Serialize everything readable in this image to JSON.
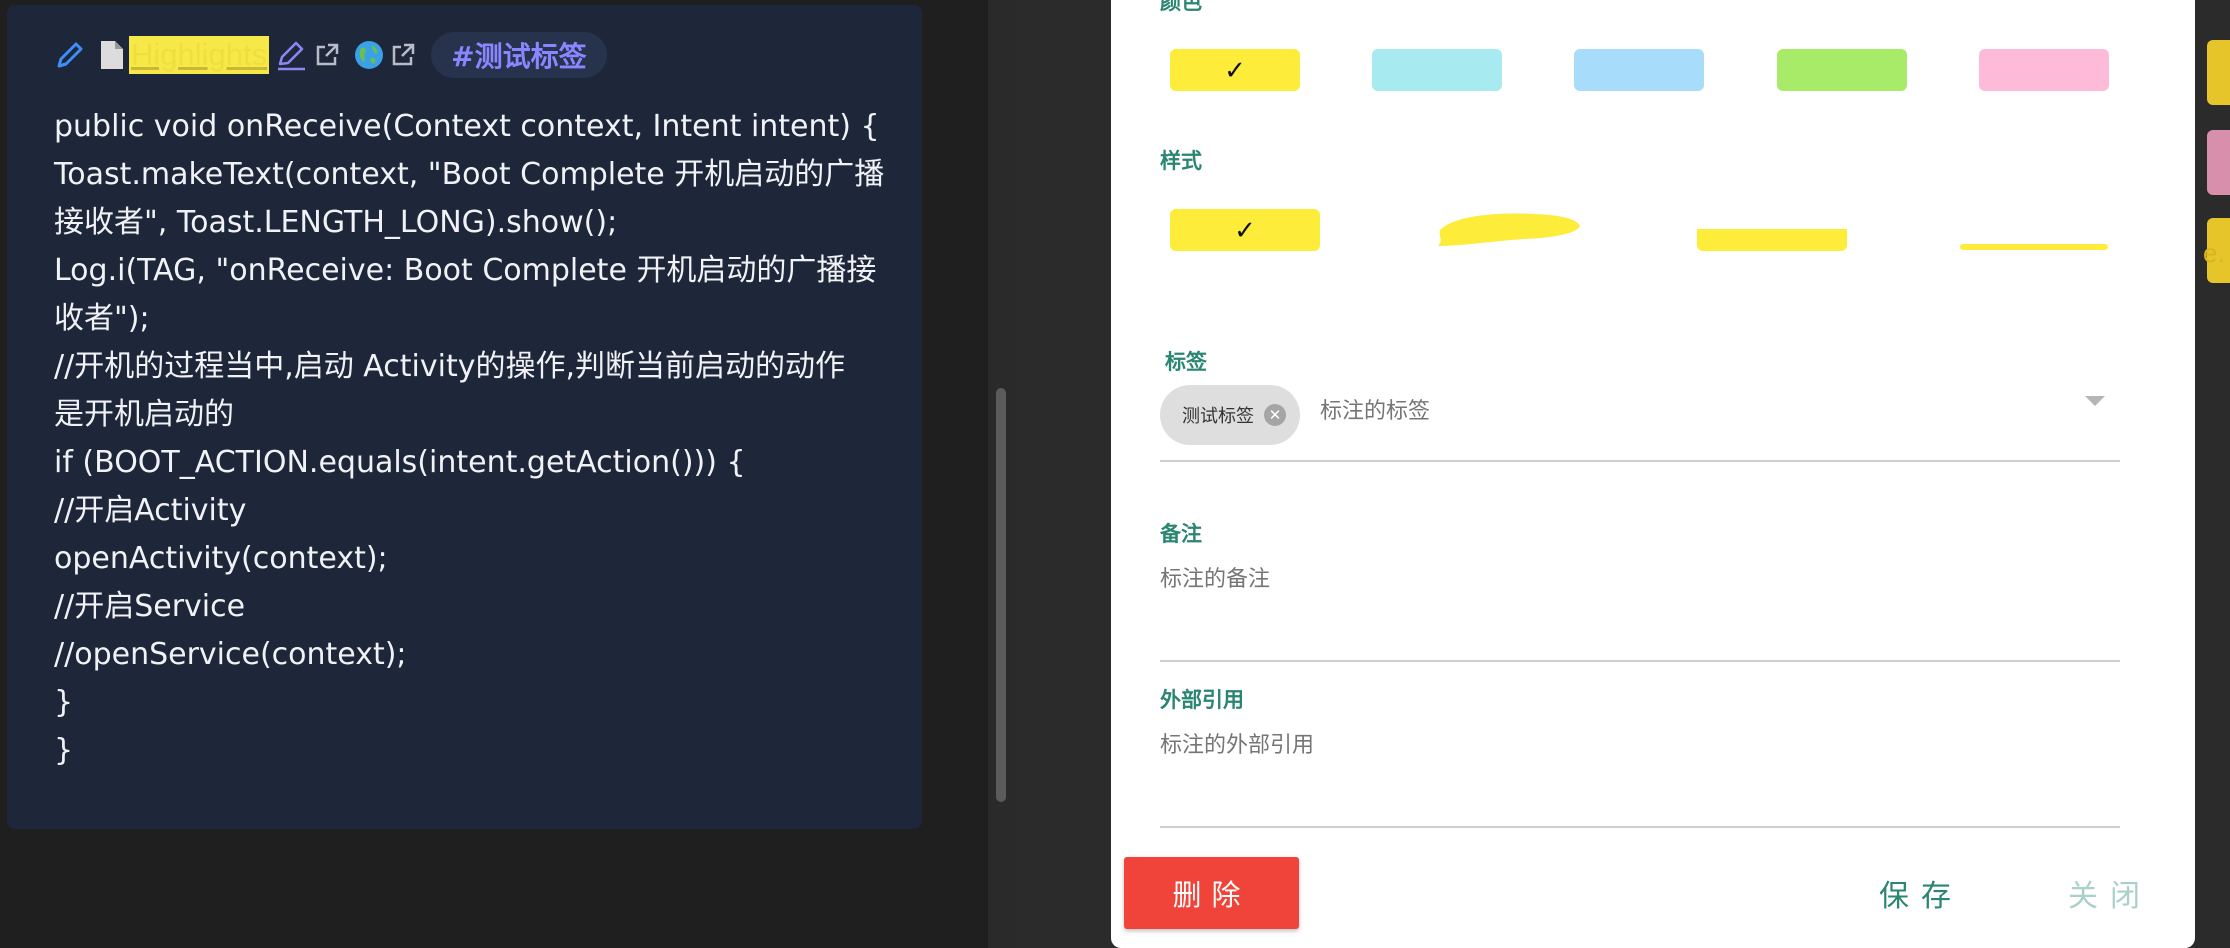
{
  "highlight_card": {
    "highlight_text": "Highlights",
    "tag": "#测试标签",
    "code_lines": [
      "public void onReceive(Context context, Intent intent) {",
      "Toast.makeText(context, \"Boot Complete 开机启动的广播",
      "接收者\", Toast.LENGTH_LONG).show();",
      "Log.i(TAG, \"onReceive: Boot Complete 开机启动的广播接",
      "收者\");",
      "//开机的过程当中,启动 Activity的操作,判断当前启动的动作",
      "是开机启动的",
      "if (BOOT_ACTION.equals(intent.getAction())) {",
      "//开启Activity",
      "openActivity(context);",
      "//开启Service",
      "//openService(context);",
      "}",
      "}"
    ],
    "icons": [
      "pencil-icon",
      "document-icon",
      "edit-icon",
      "external-link-icon",
      "globe-icon",
      "external-link-icon"
    ]
  },
  "modal": {
    "color_label": "颜色",
    "colors": [
      "#fdec3a",
      "#a7eaf0",
      "#a8dcfb",
      "#a8eb68",
      "#fdbbd9"
    ],
    "selected_color": 0,
    "check_mark": "✓",
    "style_label": "样式",
    "styles": [
      "fill",
      "brush",
      "bar",
      "underline"
    ],
    "selected_style": 0,
    "tag_label": "标签",
    "tag_chip": "测试标签",
    "tag_placeholder": "标注的标签",
    "note_label": "备注",
    "note_placeholder": "标注的备注",
    "ref_label": "外部引用",
    "ref_placeholder": "标注的外部引用",
    "delete_label": "删除",
    "save_label": "保存",
    "close_label": "关闭",
    "accent_color": "#2a8572",
    "danger_color": "#f0443a"
  }
}
